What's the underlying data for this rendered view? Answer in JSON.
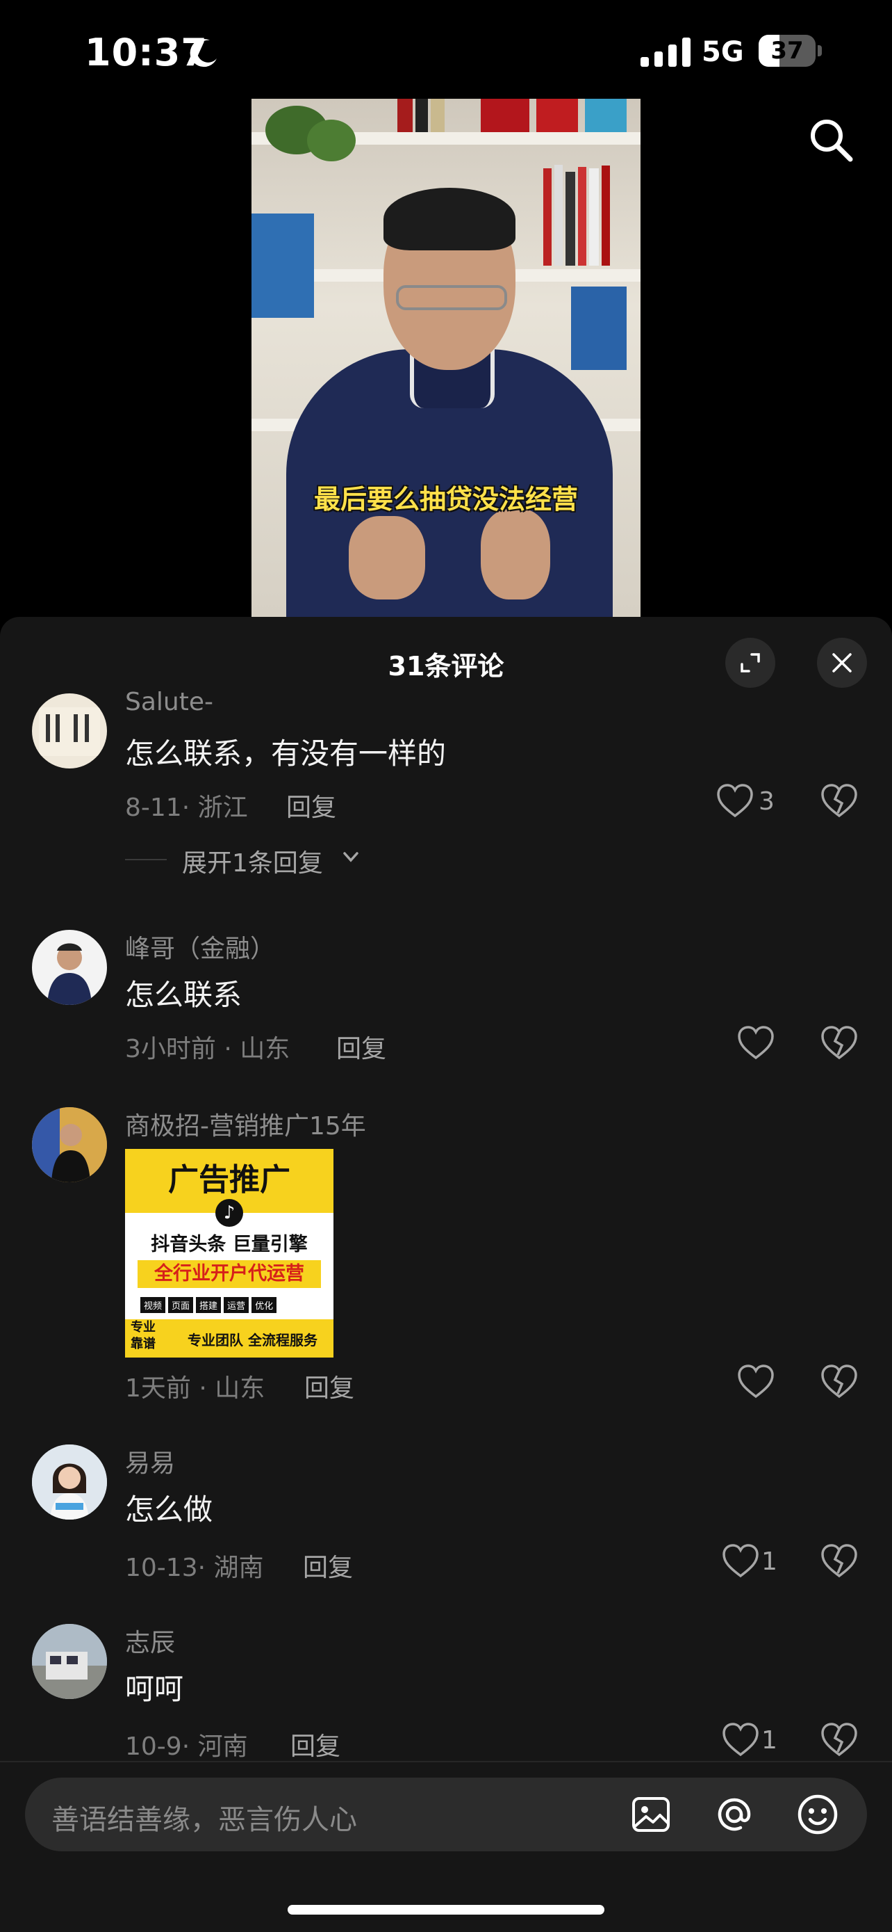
{
  "status_bar": {
    "time": "10:37",
    "network": "5G",
    "battery": "37",
    "battery_level": 0.37
  },
  "video": {
    "subtitle": "最后要么抽贷没法经营"
  },
  "comments_panel": {
    "title": "31条评论",
    "comments": [
      {
        "user": "Salute-",
        "text": "怎么联系，有没有一样的",
        "meta": "8-11· 浙江",
        "reply": "回复",
        "likes": "3",
        "expand": "展开1条回复"
      },
      {
        "user": "峰哥（金融）",
        "text": "怎么联系",
        "meta": "3小时前 · 山东",
        "reply": "回复",
        "likes": ""
      },
      {
        "user": "商极招-营销推广15年",
        "meta": "1天前 · 山东",
        "reply": "回复",
        "likes": "",
        "image": {
          "title": "广告推广",
          "row1": "抖音头条  巨量引擎",
          "row2": "全行业开户代运营",
          "tags": [
            "视频",
            "页面",
            "搭建",
            "运营",
            "优化"
          ],
          "left": "专业\n靠谱",
          "right": "专业团队 全流程服务"
        }
      },
      {
        "user": "易易",
        "text": "怎么做",
        "meta": "10-13· 湖南",
        "reply": "回复",
        "likes": "1"
      },
      {
        "user": "志辰",
        "text": "呵呵",
        "meta": "10-9· 河南",
        "reply": "回复",
        "likes": "1"
      }
    ]
  },
  "input": {
    "placeholder": "善语结善缘，恶言伤人心"
  }
}
